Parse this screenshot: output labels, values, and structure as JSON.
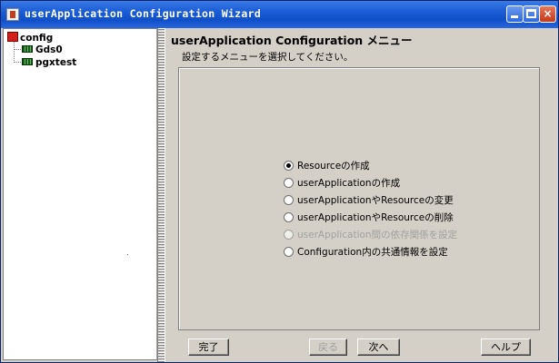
{
  "window": {
    "title": "userApplication Configuration Wizard",
    "controls": {
      "minimize": "minimize-icon",
      "maximize": "maximize-icon",
      "close": "×"
    }
  },
  "tree": {
    "root": {
      "label": "config",
      "icon": "config-icon"
    },
    "children": [
      {
        "label": "Gds0",
        "icon": "resource-icon"
      },
      {
        "label": "pgxtest",
        "icon": "resource-icon"
      }
    ]
  },
  "main": {
    "title": "userApplication Configuration メニュー",
    "description": "設定するメニューを選択してください。",
    "options": [
      {
        "label": "Resourceの作成",
        "selected": true,
        "enabled": true
      },
      {
        "label": "userApplicationの作成",
        "selected": false,
        "enabled": true
      },
      {
        "label": "userApplicationやResourceの変更",
        "selected": false,
        "enabled": true
      },
      {
        "label": "userApplicationやResourceの削除",
        "selected": false,
        "enabled": true
      },
      {
        "label": "userApplication間の依存関係を設定",
        "selected": false,
        "enabled": false
      },
      {
        "label": "Configuration内の共通情報を設定",
        "selected": false,
        "enabled": true
      }
    ]
  },
  "buttons": {
    "finish": "完了",
    "back": "戻る",
    "next": "次へ",
    "help": "ヘルプ"
  },
  "colors": {
    "titlebar": "#1d5fd6",
    "window_bg": "#d4d0c8",
    "disabled_text": "#a0a0a0"
  }
}
